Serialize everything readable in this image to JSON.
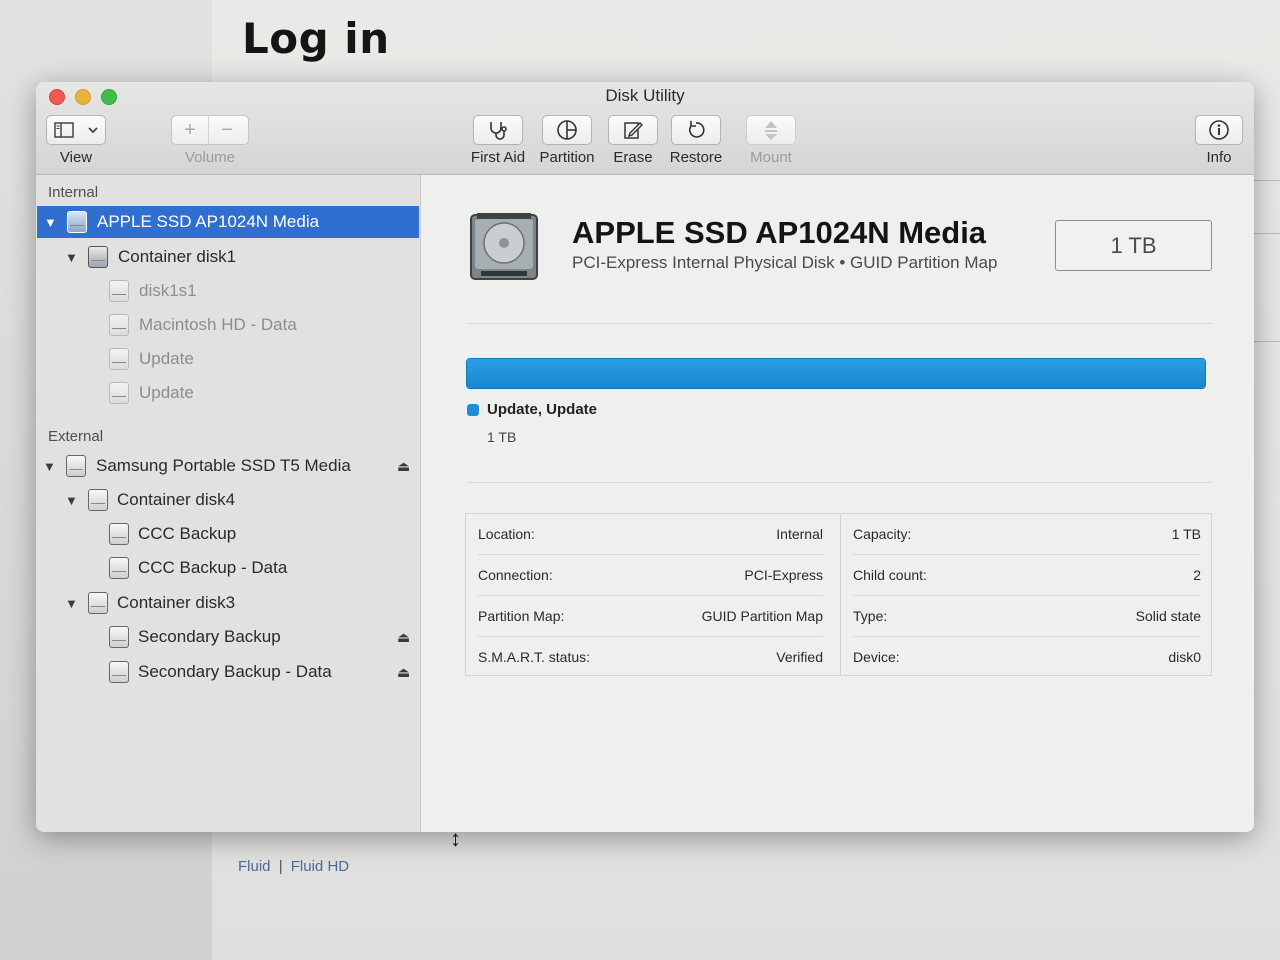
{
  "background": {
    "page_title": "Log in",
    "footer_left": "Fluid",
    "footer_sep": "|",
    "footer_right": "Fluid HD"
  },
  "window": {
    "title": "Disk Utility",
    "toolbar": {
      "view_label": "View",
      "volume_label": "Volume",
      "first_aid_label": "First Aid",
      "partition_label": "Partition",
      "erase_label": "Erase",
      "restore_label": "Restore",
      "mount_label": "Mount",
      "info_label": "Info"
    }
  },
  "sidebar": {
    "internal_label": "Internal",
    "external_label": "External",
    "internal_items": [
      {
        "label": "APPLE SSD AP1024N Media"
      },
      {
        "label": "Container disk1"
      },
      {
        "label": "disk1s1"
      },
      {
        "label": "Macintosh HD - Data"
      },
      {
        "label": "Update"
      },
      {
        "label": "Update"
      }
    ],
    "external_items": [
      {
        "label": "Samsung Portable SSD T5 Media"
      },
      {
        "label": "Container disk4"
      },
      {
        "label": "CCC Backup"
      },
      {
        "label": "CCC Backup - Data"
      },
      {
        "label": "Container disk3"
      },
      {
        "label": "Secondary Backup"
      },
      {
        "label": "Secondary Backup - Data"
      }
    ],
    "selected_color": "#2f6fd1"
  },
  "detail": {
    "name": "APPLE SSD AP1024N Media",
    "subtitle": "PCI-Express Internal Physical Disk • GUID Partition Map",
    "size": "1 TB",
    "usage": {
      "fill_fraction": 1.0,
      "color": "#1e8fd4",
      "legend_name": "Update, Update",
      "legend_size": "1 TB"
    },
    "info_left": [
      {
        "key": "Location:",
        "value": "Internal"
      },
      {
        "key": "Connection:",
        "value": "PCI-Express"
      },
      {
        "key": "Partition Map:",
        "value": "GUID Partition Map"
      },
      {
        "key": "S.M.A.R.T. status:",
        "value": "Verified"
      }
    ],
    "info_right": [
      {
        "key": "Capacity:",
        "value": "1 TB"
      },
      {
        "key": "Child count:",
        "value": "2"
      },
      {
        "key": "Type:",
        "value": "Solid state"
      },
      {
        "key": "Device:",
        "value": "disk0"
      }
    ]
  }
}
